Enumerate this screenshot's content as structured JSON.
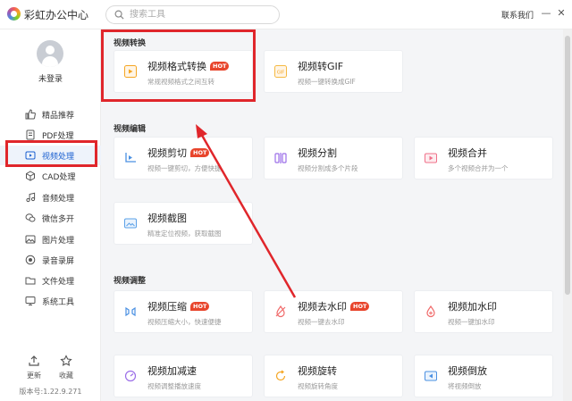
{
  "app": {
    "title": "彩虹办公中心",
    "contact": "联系我们"
  },
  "search": {
    "placeholder": "搜索工具"
  },
  "window_controls": {
    "minimize": "—",
    "close": "✕"
  },
  "user": {
    "login": "未登录"
  },
  "sidebar": {
    "items": [
      {
        "label": "精品推荐",
        "icon": "thumbs-up-icon"
      },
      {
        "label": "PDF处理",
        "icon": "pdf-icon"
      },
      {
        "label": "视频处理",
        "icon": "video-icon",
        "active": true
      },
      {
        "label": "CAD处理",
        "icon": "cad-icon"
      },
      {
        "label": "音频处理",
        "icon": "music-icon"
      },
      {
        "label": "微信多开",
        "icon": "wechat-icon"
      },
      {
        "label": "图片处理",
        "icon": "image-icon"
      },
      {
        "label": "录音录屏",
        "icon": "record-icon"
      },
      {
        "label": "文件处理",
        "icon": "file-icon"
      },
      {
        "label": "系统工具",
        "icon": "system-icon"
      }
    ],
    "update": "更新",
    "favorite": "收藏",
    "version": "版本号:1.22.9.271"
  },
  "badge": {
    "hot": "HOT"
  },
  "sections": [
    {
      "title": "视频转换",
      "cards": [
        {
          "title": "视频格式转换",
          "desc": "常规视频格式之间互转",
          "hot": true,
          "color": "#f5a623"
        },
        {
          "title": "视频转GIF",
          "desc": "视频一键转换成GIF",
          "hot": false,
          "color": "#f5b942"
        }
      ]
    },
    {
      "title": "视频编辑",
      "cards": [
        {
          "title": "视频剪切",
          "desc": "视频一键剪切，方便快捷",
          "hot": true,
          "color": "#4a90e2"
        },
        {
          "title": "视频分割",
          "desc": "视频分割成多个片段",
          "hot": false,
          "color": "#9b6ee8"
        },
        {
          "title": "视频合并",
          "desc": "多个视频合并为一个",
          "hot": false,
          "color": "#f0708a"
        },
        {
          "title": "视频截图",
          "desc": "精准定位视频，获取截图",
          "hot": false,
          "color": "#5aa0e8"
        }
      ]
    },
    {
      "title": "视频调整",
      "cards": [
        {
          "title": "视频压缩",
          "desc": "视频压缩大小，快速便捷",
          "hot": true,
          "color": "#4a90e2"
        },
        {
          "title": "视频去水印",
          "desc": "视频一键去水印",
          "hot": true,
          "color": "#f06a6a"
        },
        {
          "title": "视频加水印",
          "desc": "视频一键加水印",
          "hot": false,
          "color": "#f06a6a"
        },
        {
          "title": "视频加减速",
          "desc": "视频调整播放速度",
          "hot": false,
          "color": "#9b6ee8"
        },
        {
          "title": "视频旋转",
          "desc": "视频旋转角度",
          "hot": false,
          "color": "#f5a623"
        },
        {
          "title": "视频倒放",
          "desc": "将视频倒放",
          "hot": false,
          "color": "#4a90e2"
        }
      ]
    }
  ]
}
